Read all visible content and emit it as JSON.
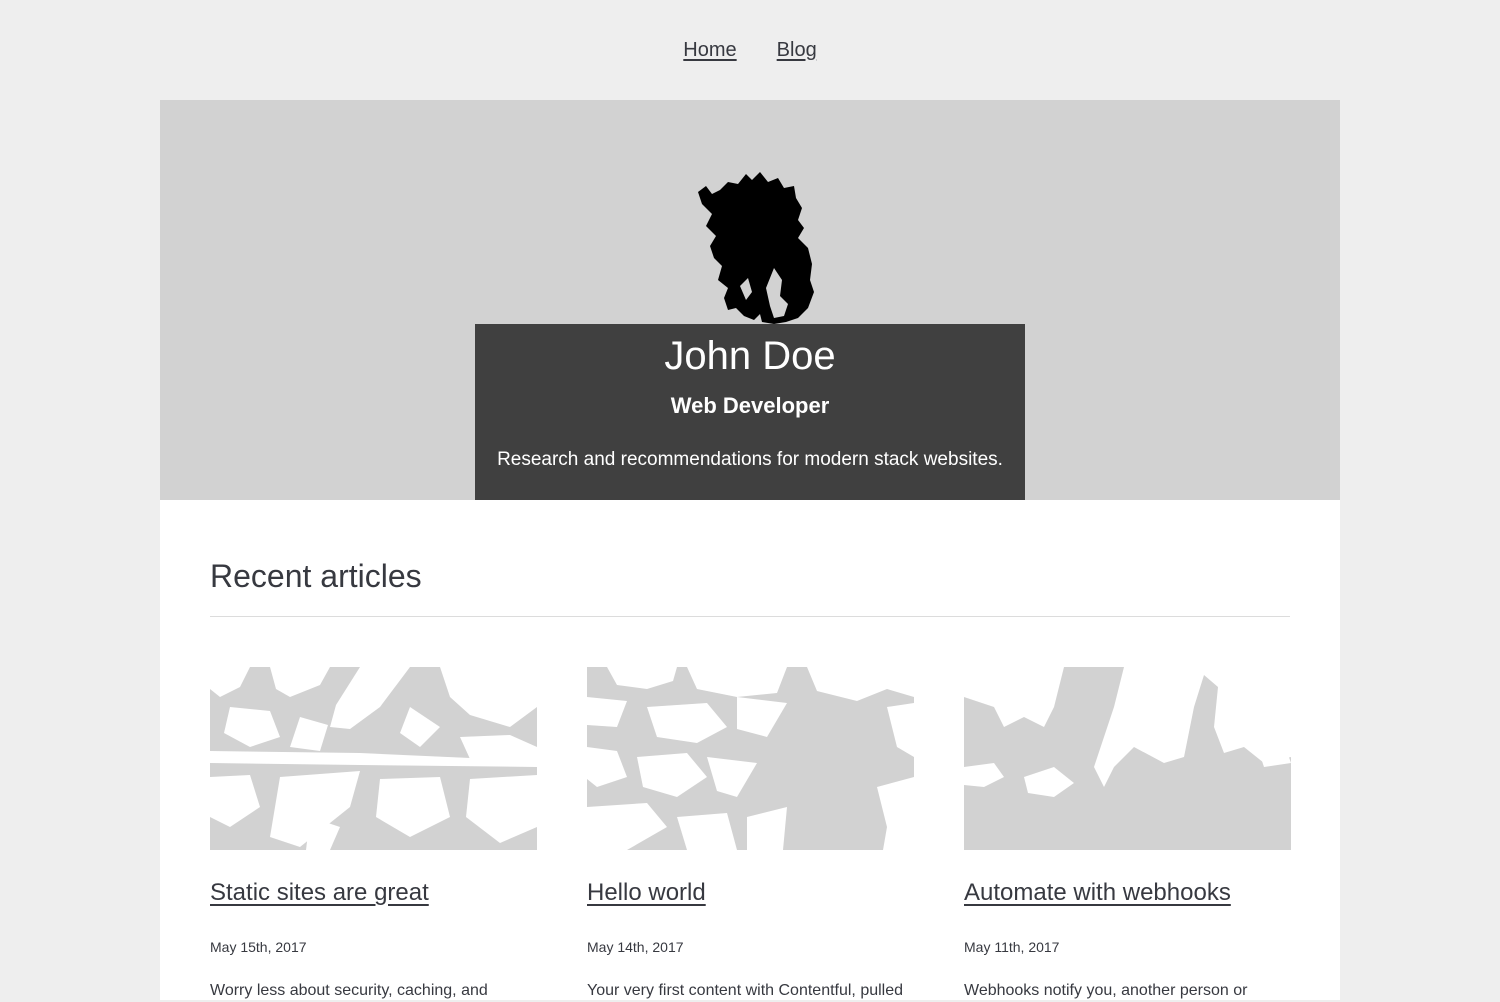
{
  "nav": {
    "home_label": "Home",
    "blog_label": "Blog"
  },
  "hero": {
    "name": "John Doe",
    "title": "Web Developer",
    "description": "Research and recommendations for modern stack websites.",
    "logo_icon": "fire-silhouette-icon",
    "background_color": "#d2d2d2",
    "box_color": "#404040"
  },
  "section": {
    "title": "Recent articles"
  },
  "articles": [
    {
      "title": "Static sites are great",
      "date": "May 15th, 2017",
      "excerpt": "Worry less about security, caching, and",
      "image_icon": "grayscale-pattern-image"
    },
    {
      "title": "Hello world",
      "date": "May 14th, 2017",
      "excerpt": "Your very first content with Contentful, pulled",
      "image_icon": "grayscale-pattern-image"
    },
    {
      "title": "Automate with webhooks",
      "date": "May 11th, 2017",
      "excerpt": "Webhooks notify you, another person or",
      "image_icon": "grayscale-pattern-image"
    }
  ],
  "colors": {
    "page_bg": "#eeeeee",
    "text": "#373940",
    "image_gray": "#d2d2d2"
  }
}
